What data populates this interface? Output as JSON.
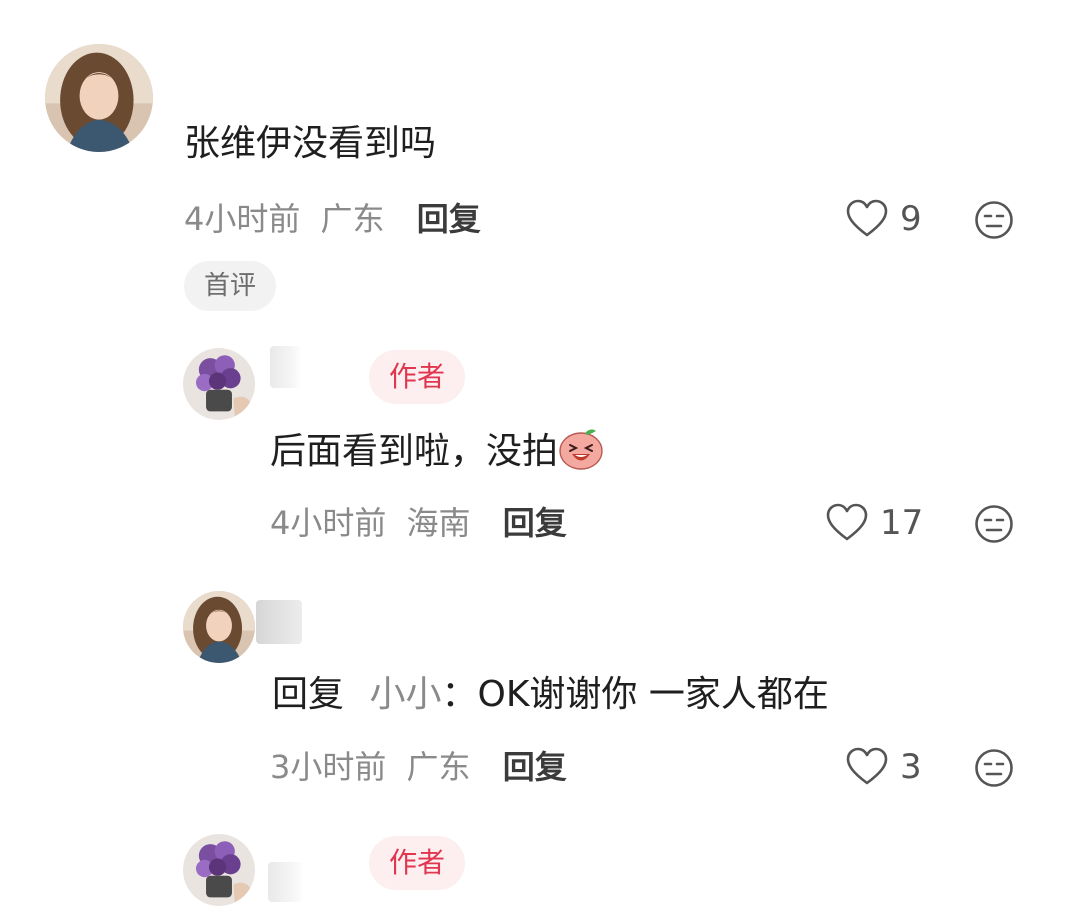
{
  "comments": [
    {
      "avatar": "woman-portrait-avatar",
      "text": "张维伊没看到吗",
      "time": "4小时前",
      "location": "广东",
      "reply_label": "回复",
      "likes": "9",
      "tag": "首评"
    },
    {
      "avatar": "purple-flowers-avatar",
      "badge": "作者",
      "text": "后面看到啦，没拍",
      "sticker": "laughing-sticker-icon",
      "time": "4小时前",
      "location": "海南",
      "reply_label": "回复",
      "likes": "17"
    },
    {
      "avatar": "woman-portrait-avatar",
      "reply_prefix": "回复",
      "reply_to": "小小",
      "text": "：OK谢谢你 一家人都在",
      "time": "3小时前",
      "location": "广东",
      "reply_label": "回复",
      "likes": "3"
    },
    {
      "avatar": "purple-flowers-avatar",
      "badge": "作者"
    }
  ],
  "colors": {
    "author_badge_text": "#e0364f",
    "author_badge_bg": "#fdeef0",
    "meta_text": "#8a8a8a",
    "tag_bg": "#f2f2f2"
  }
}
